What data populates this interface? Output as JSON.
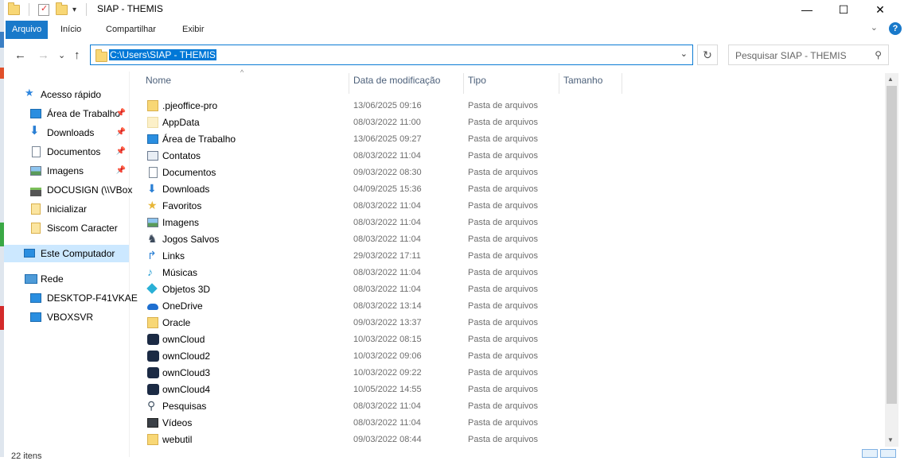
{
  "window": {
    "title": "SIAP - THEMIS",
    "minimize_glyph": "—",
    "maximize_glyph": "☐",
    "close_glyph": "✕"
  },
  "ribbon": {
    "tabs": [
      "Arquivo",
      "Início",
      "Compartilhar",
      "Exibir"
    ],
    "help_glyph": "?",
    "collapse_glyph": "⌄"
  },
  "nav": {
    "back_glyph": "←",
    "forward_glyph": "→",
    "recent_glyph": "⌄",
    "up_glyph": "↑",
    "address": "C:\\Users\\SIAP - THEMIS",
    "address_drop_glyph": "⌄",
    "refresh_glyph": "↻",
    "search_placeholder": "Pesquisar SIAP - THEMIS",
    "search_glyph": "⚲"
  },
  "sidebar": {
    "quick_access": "Acesso rápido",
    "items": [
      {
        "label": "Área de Trabalho",
        "icon": "desktop-icon",
        "pinned": true
      },
      {
        "label": "Downloads",
        "icon": "downloads-icon",
        "pinned": true
      },
      {
        "label": "Documentos",
        "icon": "documents-icon",
        "pinned": true
      },
      {
        "label": "Imagens",
        "icon": "pictures-icon",
        "pinned": true
      },
      {
        "label": "DOCUSIGN (\\\\VBox",
        "icon": "network-drive-icon",
        "pinned": false
      },
      {
        "label": "Inicializar",
        "icon": "folder-icon",
        "pinned": false
      },
      {
        "label": "Siscom Caracter",
        "icon": "folder-icon",
        "pinned": false
      }
    ],
    "this_pc": "Este Computador",
    "network": "Rede",
    "network_items": [
      "DESKTOP-F41VKAE",
      "VBOXSVR"
    ],
    "pin_glyph": "📌"
  },
  "columns": {
    "name": "Nome",
    "date": "Data de modificação",
    "type": "Tipo",
    "size": "Tamanho",
    "sort_glyph": "^"
  },
  "files": [
    {
      "name": ".pjeoffice-pro",
      "date": "13/06/2025 09:16",
      "type": "Pasta de arquivos",
      "icon": "folder-icon"
    },
    {
      "name": "AppData",
      "date": "08/03/2022 11:00",
      "type": "Pasta de arquivos",
      "icon": "folder-hidden-icon"
    },
    {
      "name": "Área de Trabalho",
      "date": "13/06/2025 09:27",
      "type": "Pasta de arquivos",
      "icon": "desktop-icon"
    },
    {
      "name": "Contatos",
      "date": "08/03/2022 11:04",
      "type": "Pasta de arquivos",
      "icon": "contacts-icon"
    },
    {
      "name": "Documentos",
      "date": "09/03/2022 08:30",
      "type": "Pasta de arquivos",
      "icon": "documents-icon"
    },
    {
      "name": "Downloads",
      "date": "04/09/2025 15:36",
      "type": "Pasta de arquivos",
      "icon": "downloads-icon"
    },
    {
      "name": "Favoritos",
      "date": "08/03/2022 11:04",
      "type": "Pasta de arquivos",
      "icon": "star-icon"
    },
    {
      "name": "Imagens",
      "date": "08/03/2022 11:04",
      "type": "Pasta de arquivos",
      "icon": "pictures-icon"
    },
    {
      "name": "Jogos Salvos",
      "date": "08/03/2022 11:04",
      "type": "Pasta de arquivos",
      "icon": "saved-games-icon"
    },
    {
      "name": "Links",
      "date": "29/03/2022 17:11",
      "type": "Pasta de arquivos",
      "icon": "links-icon"
    },
    {
      "name": "Músicas",
      "date": "08/03/2022 11:04",
      "type": "Pasta de arquivos",
      "icon": "music-icon"
    },
    {
      "name": "Objetos 3D",
      "date": "08/03/2022 11:04",
      "type": "Pasta de arquivos",
      "icon": "objects-3d-icon"
    },
    {
      "name": "OneDrive",
      "date": "08/03/2022 13:14",
      "type": "Pasta de arquivos",
      "icon": "onedrive-icon"
    },
    {
      "name": "Oracle",
      "date": "09/03/2022 13:37",
      "type": "Pasta de arquivos",
      "icon": "folder-icon"
    },
    {
      "name": "ownCloud",
      "date": "10/03/2022 08:15",
      "type": "Pasta de arquivos",
      "icon": "owncloud-icon"
    },
    {
      "name": "ownCloud2",
      "date": "10/03/2022 09:06",
      "type": "Pasta de arquivos",
      "icon": "owncloud-icon"
    },
    {
      "name": "ownCloud3",
      "date": "10/03/2022 09:22",
      "type": "Pasta de arquivos",
      "icon": "owncloud-icon"
    },
    {
      "name": "ownCloud4",
      "date": "10/05/2022 14:55",
      "type": "Pasta de arquivos",
      "icon": "owncloud-icon"
    },
    {
      "name": "Pesquisas",
      "date": "08/03/2022 11:04",
      "type": "Pasta de arquivos",
      "icon": "searches-icon"
    },
    {
      "name": "Vídeos",
      "date": "08/03/2022 11:04",
      "type": "Pasta de arquivos",
      "icon": "videos-icon"
    },
    {
      "name": "webutil",
      "date": "09/03/2022 08:44",
      "type": "Pasta de arquivos",
      "icon": "folder-icon"
    }
  ],
  "status": {
    "count_text": "22 itens"
  },
  "colors": {
    "accent": "#1979ca",
    "selection": "#cce8ff",
    "address_highlight": "#0078d7"
  }
}
